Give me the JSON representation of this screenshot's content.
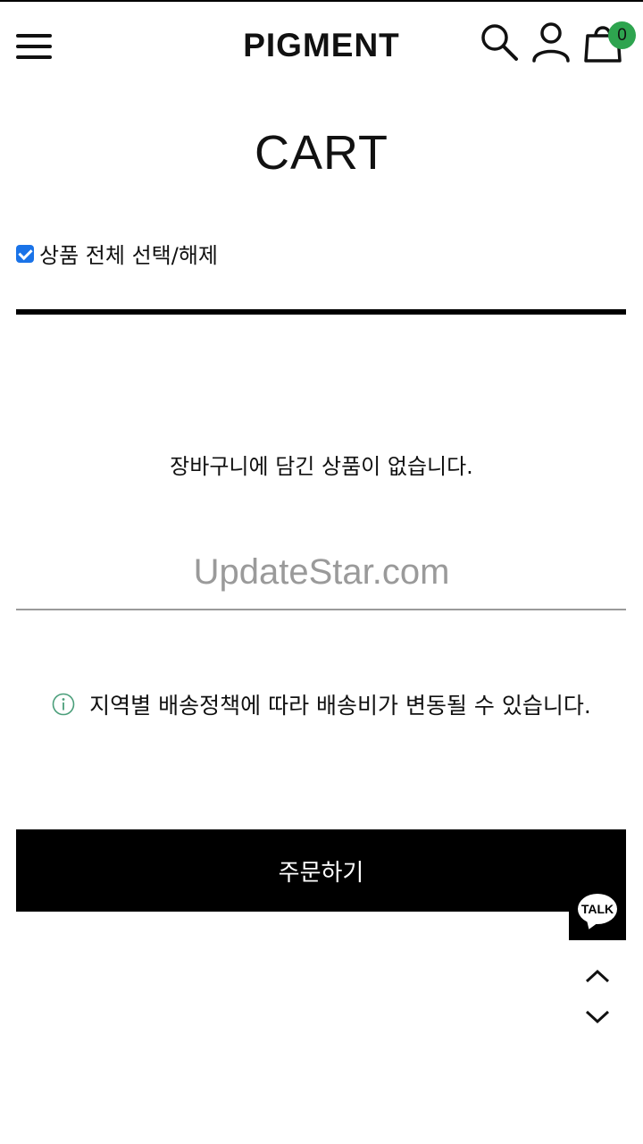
{
  "header": {
    "logo": "PIGMENT",
    "cart_count": "0",
    "icons": [
      "menu-icon",
      "search-icon",
      "user-icon",
      "shopping-bag-icon"
    ]
  },
  "page": {
    "title": "CART"
  },
  "cart": {
    "select_all_label": "상품 전체 선택/해제",
    "select_all_checked": true,
    "empty_message": "장바구니에 담긴 상품이 없습니다."
  },
  "watermark": "UpdateStar.com",
  "notice": {
    "icon": "info-icon",
    "text": "지역별 배송정책에 따라 배송비가 변동될 수 있습니다."
  },
  "order_button_label": "주문하기",
  "floating": {
    "talk_label": "TALK",
    "scroll_icons": [
      "chevron-up-icon",
      "chevron-down-icon"
    ]
  },
  "colors": {
    "badge": "#2ea44f",
    "checkbox": "#1a73e8",
    "button_bg": "#000000",
    "watermark": "#9a9a9a"
  }
}
